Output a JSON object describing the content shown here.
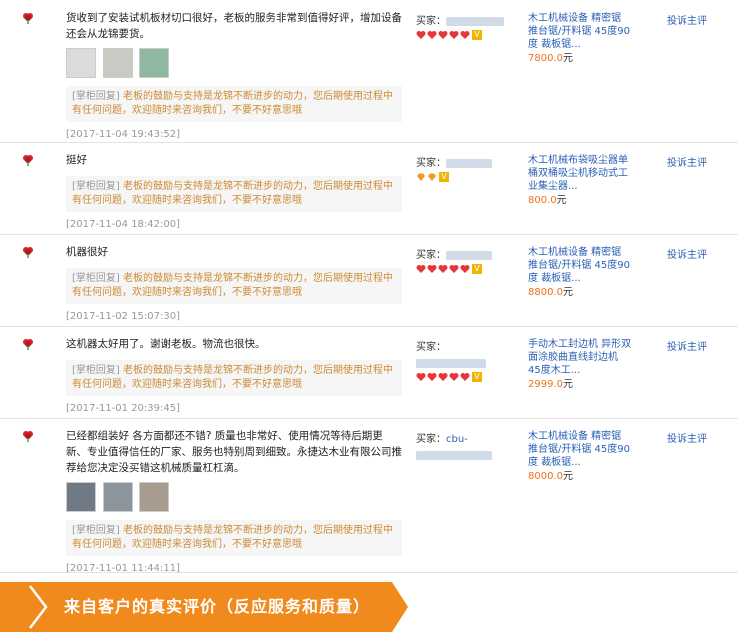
{
  "reviews": [
    {
      "text": "货收到了安装试机板材切口很好，老板的服务非常到值得好评，增加设备还会从龙锦要货。",
      "photos": 3,
      "reply_tag": "[掌柜回复]",
      "reply": "老板的鼓励与支持是龙锦不断进步的动力，您后期使用过程中有任何问题，欢迎随时来咨询我们，不要不好意思哦",
      "time": "[2017-11-04 19:43:52]",
      "buyer_label": "买家：",
      "hearts": 5,
      "product": "木工机械设备 精密锯 推台锯/开料锯 45度90度 裁板锯...",
      "price": "7800.0",
      "yuan": "元",
      "complain": "投诉主评"
    },
    {
      "text": "挺好",
      "photos": 0,
      "reply_tag": "[掌柜回复]",
      "reply": "老板的鼓励与支持是龙锦不断进步的动力，您后期使用过程中有任何问题，欢迎随时来咨询我们，不要不好意思哦",
      "time": "[2017-11-04 18:42:00]",
      "buyer_label": "买家：",
      "hearts": 2,
      "product": "木工机械布袋吸尘器单桶双桶吸尘机移动式工业集尘器...",
      "price": "800.0",
      "yuan": "元",
      "complain": "投诉主评"
    },
    {
      "text": "机器很好",
      "photos": 0,
      "reply_tag": "[掌柜回复]",
      "reply": "老板的鼓励与支持是龙锦不断进步的动力，您后期使用过程中有任何问题，欢迎随时来咨询我们，不要不好意思哦",
      "time": "[2017-11-02 15:07:30]",
      "buyer_label": "买家：",
      "hearts": 5,
      "product": "木工机械设备 精密锯 推台锯/开料锯 45度90度 裁板锯...",
      "price": "8800.0",
      "yuan": "元",
      "complain": "投诉主评"
    },
    {
      "text": "这机器太好用了。谢谢老板。物流也很快。",
      "photos": 0,
      "reply_tag": "[掌柜回复]",
      "reply": "老板的鼓励与支持是龙锦不断进步的动力，您后期使用过程中有任何问题，欢迎随时来咨询我们，不要不好意思哦",
      "time": "[2017-11-01 20:39:45]",
      "buyer_label": "买家：",
      "hearts": 5,
      "product": "手动木工封边机 异形双面涂胶曲直线封边机 45度木工...",
      "price": "2999.0",
      "yuan": "元",
      "complain": "投诉主评"
    },
    {
      "text": "已经都组装好 各方面都还不错? 质量也非常好、使用情况等待后期更新、专业值得信任的厂家、服务也特别周到细致。永捷达木业有限公司推荐给您决定没买错这机械质量杠杠滴。",
      "photos": 3,
      "reply_tag": "[掌柜回复]",
      "reply": "老板的鼓励与支持是龙锦不断进步的动力，您后期使用过程中有任何问题，欢迎随时来咨询我们，不要不好意思哦",
      "time": "[2017-11-01 11:44:11]",
      "buyer_label": "买家：",
      "buyer_prefix": "cbu-",
      "hearts": 0,
      "product": "木工机械设备 精密锯 推台锯/开料锯 45度90度 裁板锯...",
      "price": "8000.0",
      "yuan": "元",
      "complain": "投诉主评"
    }
  ],
  "banner": {
    "text": "来自客户的真实评价（反应服务和质量）",
    "color": "#f08a1c"
  },
  "colors": {
    "link": "#2b5fb5",
    "price": "#f07020",
    "reply": "#cc8a33",
    "heart": "#e8353a"
  }
}
